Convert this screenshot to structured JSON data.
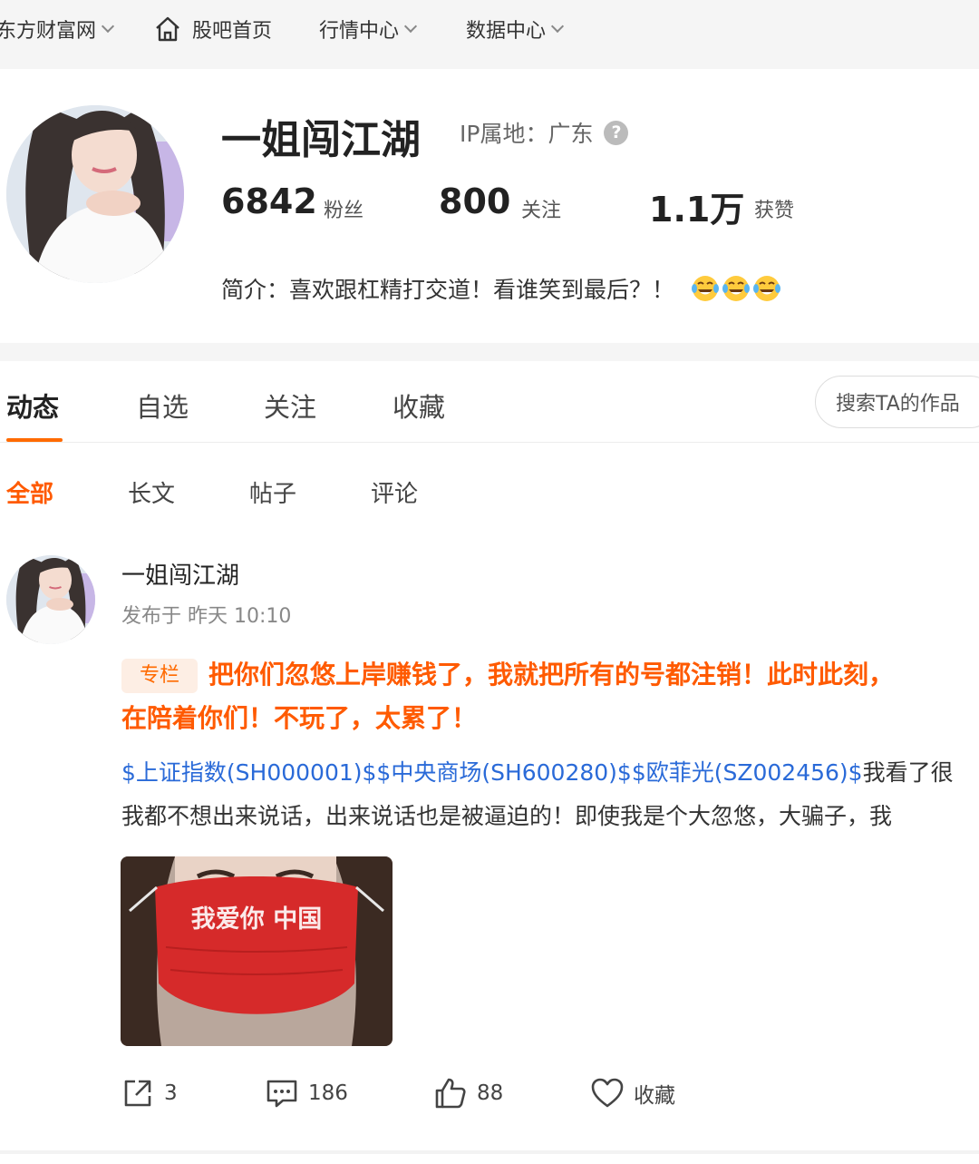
{
  "topnav": {
    "items": [
      {
        "label": "东方财富网"
      },
      {
        "label": "股吧首页"
      },
      {
        "label": "行情中心"
      },
      {
        "label": "数据中心"
      }
    ]
  },
  "profile": {
    "username": "一姐闯江湖",
    "ip_label": "IP属地：广东",
    "help_glyph": "?",
    "stats": [
      {
        "value": "6842",
        "label": "粉丝"
      },
      {
        "value": "800",
        "label": "关注"
      },
      {
        "value": "1.1万",
        "label": "获赞"
      }
    ],
    "bio": "简介：喜欢跟杠精打交道！看谁笑到最后？！",
    "bio_emoji": "laughing-tears-emoji"
  },
  "tabs": {
    "items": [
      {
        "label": "动态"
      },
      {
        "label": "自选"
      },
      {
        "label": "关注"
      },
      {
        "label": "收藏"
      }
    ],
    "search_label": "搜索TA的作品"
  },
  "subtabs": {
    "items": [
      {
        "label": "全部"
      },
      {
        "label": "长文"
      },
      {
        "label": "帖子"
      },
      {
        "label": "评论"
      }
    ]
  },
  "post": {
    "author": "一姐闯江湖",
    "time": "发布于 昨天 10:10",
    "tag": "专栏",
    "title_line1": "把你们忽悠上岸赚钱了，我就把所有的号都注销！此时此刻，",
    "title_line2": "在陪着你们！不玩了，太累了！",
    "stocks": "$上证指数(SH000001)$$中央商场(SH600280)$$欧菲光(SZ002456)$",
    "body_line1_tail": "我看了很",
    "body_line2": "我都不想出来说话，出来说话也是被逼迫的！即使我是个大忽悠，大骗子，我",
    "image_text": "我爱你 中国",
    "actions": {
      "share_count": "3",
      "comment_count": "186",
      "like_count": "88",
      "favorite_label": "收藏"
    }
  },
  "colors": {
    "accent": "#ff5a00",
    "link": "#2a6ad8",
    "mask_red": "#d62a2a"
  }
}
